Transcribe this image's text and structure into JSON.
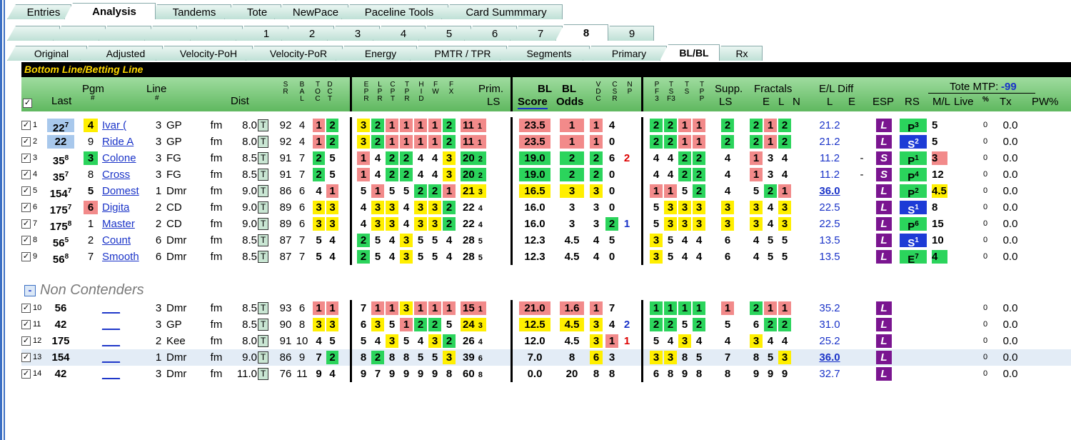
{
  "tabs_main": [
    "Entries",
    "Analysis",
    "Tandems",
    "Tote",
    "NewPace",
    "Paceline Tools",
    "Card Summmary"
  ],
  "tabs_races": [
    "",
    "",
    "",
    "",
    "",
    "1",
    "2",
    "3",
    "4",
    "5",
    "6",
    "7",
    "8",
    "9"
  ],
  "tabs_sub": [
    "Original",
    "Adjusted",
    "Velocity-PoH",
    "Velocity-PoR",
    "Energy",
    "PMTR / TPR",
    "Segments",
    "Primary",
    "BL/BL",
    "Rx"
  ],
  "title": "Bottom Line/Betting Line",
  "headers": {
    "last": "Last",
    "pgm": "Pgm",
    "pgm2": "#",
    "line": "Line",
    "line2": "#",
    "dist": "Dist",
    "sr": "S R",
    "bal": "B A L",
    "toc": "T O C",
    "dct": "D C T",
    "e": "E P R",
    "l": "L P R",
    "c": "C P T",
    "t": "T P R",
    "hd": "H I D",
    "w": "F W",
    "fx": "F X",
    "prim": "Prim.",
    "ls": "LS",
    "bl1": "BL",
    "bl2": "BL",
    "score": "Score",
    "odds": "Odds",
    "vdc": "V D C",
    "csr": "C S R",
    "np": "N P",
    "pf": "P F 3",
    "tf": "T S F3",
    "ts": "T S",
    "tp": "T P P",
    "supp": "Supp.",
    "suppls": "LS",
    "fract": "Fractals",
    "e2": "E",
    "l2": "L",
    "n2": "N",
    "eldiff": "E/L Diff",
    "el_l": "L",
    "el_e": "E",
    "esp": "ESP",
    "rs": "RS",
    "tote": "Tote MTP:",
    "mtp": "-99",
    "ml": "M/L",
    "live": "Live",
    "pct": "%",
    "tx": "Tx",
    "pw": "PW%"
  },
  "rows": [
    {
      "n": "1",
      "last": "22",
      "sup": "7",
      "pgm": "4",
      "name": "Ivar (",
      "line": "3",
      "trk": "GP",
      "surf": "fm",
      "dist": "8.0",
      "sr": "92",
      "bal": "4",
      "toc": "1",
      "dct": "2",
      "fr": [
        "3",
        "2",
        "1",
        "1",
        "1",
        "1",
        "2"
      ],
      "prim": "11",
      "pls": "1",
      "score": "23.5",
      "odds": "1",
      "vdc": "1",
      "csr": "4",
      "np": "",
      "pc": [
        "2",
        "2",
        "1",
        "1"
      ],
      "supp": "2",
      "fx": [
        "2",
        "1",
        "2"
      ],
      "el": "21.2",
      "dash": "",
      "esp": "L",
      "rs": "P",
      "rss": "3",
      "ml": "5",
      "live": "0",
      "pct": "0.0"
    },
    {
      "n": "2",
      "last": "22",
      "sup": "",
      "pgm": "9",
      "name": "Ride A",
      "line": "3",
      "trk": "GP",
      "surf": "fm",
      "dist": "8.0",
      "sr": "92",
      "bal": "4",
      "toc": "1",
      "dct": "2",
      "fr": [
        "3",
        "2",
        "1",
        "1",
        "1",
        "1",
        "2"
      ],
      "prim": "11",
      "pls": "1",
      "score": "23.5",
      "odds": "1",
      "vdc": "1",
      "csr": "0",
      "np": "",
      "pc": [
        "2",
        "2",
        "1",
        "1"
      ],
      "supp": "2",
      "fx": [
        "2",
        "1",
        "2"
      ],
      "el": "21.2",
      "dash": "",
      "esp": "L",
      "rs": "S",
      "rss": "2",
      "ml": "5",
      "live": "0",
      "pct": "0.0"
    },
    {
      "n": "3",
      "last": "35",
      "sup": "8",
      "pgm": "3",
      "name": "Colone",
      "line": "3",
      "trk": "FG",
      "surf": "fm",
      "dist": "8.5",
      "sr": "91",
      "bal": "7",
      "toc": "2",
      "dct": "5",
      "fr": [
        "1",
        "4",
        "2",
        "2",
        "4",
        "4",
        "3"
      ],
      "prim": "20",
      "pls": "2",
      "score": "19.0",
      "odds": "2",
      "vdc": "2",
      "csr": "6",
      "np": "2",
      "pc": [
        "4",
        "4",
        "2",
        "2"
      ],
      "supp": "4",
      "fx": [
        "1",
        "3",
        "4"
      ],
      "el": "11.2",
      "dash": "-",
      "esp": "S",
      "rs": "P",
      "rss": "1",
      "ml": "3",
      "live": "0",
      "pct": "0.0"
    },
    {
      "n": "4",
      "last": "35",
      "sup": "7",
      "pgm": "8",
      "name": "Cross",
      "line": "3",
      "trk": "FG",
      "surf": "fm",
      "dist": "8.5",
      "sr": "91",
      "bal": "7",
      "toc": "2",
      "dct": "5",
      "fr": [
        "1",
        "4",
        "2",
        "2",
        "4",
        "4",
        "3"
      ],
      "prim": "20",
      "pls": "2",
      "score": "19.0",
      "odds": "2",
      "vdc": "2",
      "csr": "0",
      "np": "",
      "pc": [
        "4",
        "4",
        "2",
        "2"
      ],
      "supp": "4",
      "fx": [
        "1",
        "3",
        "4"
      ],
      "el": "11.2",
      "dash": "-",
      "esp": "S",
      "rs": "P",
      "rss": "4",
      "ml": "12",
      "live": "0",
      "pct": "0.0"
    },
    {
      "n": "5",
      "last": "154",
      "sup": "7",
      "pgm": "5",
      "name": "Domest",
      "line": "1",
      "trk": "Dmr",
      "surf": "fm",
      "dist": "9.0",
      "sr": "86",
      "bal": "6",
      "toc": "4",
      "dct": "1",
      "fr": [
        "5",
        "1",
        "5",
        "5",
        "2",
        "2",
        "1"
      ],
      "prim": "21",
      "pls": "3",
      "score": "16.5",
      "odds": "3",
      "vdc": "3",
      "csr": "0",
      "np": "",
      "pc": [
        "1",
        "1",
        "5",
        "2"
      ],
      "supp": "4",
      "fx": [
        "5",
        "2",
        "1"
      ],
      "el": "36.0",
      "dash": "",
      "esp": "L",
      "rs": "P",
      "rss": "2",
      "ml": "4.5",
      "live": "0",
      "pct": "0.0"
    },
    {
      "n": "6",
      "last": "175",
      "sup": "7",
      "pgm": "6",
      "name": "Digita",
      "line": "2",
      "trk": "CD",
      "surf": "fm",
      "dist": "9.0",
      "sr": "89",
      "bal": "6",
      "toc": "3",
      "dct": "3",
      "fr": [
        "4",
        "3",
        "3",
        "4",
        "3",
        "3",
        "2"
      ],
      "prim": "22",
      "pls": "4",
      "score": "16.0",
      "odds": "3",
      "vdc": "3",
      "csr": "0",
      "np": "",
      "pc": [
        "5",
        "3",
        "3",
        "3"
      ],
      "supp": "3",
      "fx": [
        "3",
        "4",
        "3"
      ],
      "el": "22.5",
      "dash": "",
      "esp": "L",
      "rs": "S",
      "rss": "1",
      "ml": "8",
      "live": "0",
      "pct": "0.0"
    },
    {
      "n": "7",
      "last": "175",
      "sup": "8",
      "pgm": "1",
      "name": "Master",
      "line": "2",
      "trk": "CD",
      "surf": "fm",
      "dist": "9.0",
      "sr": "89",
      "bal": "6",
      "toc": "3",
      "dct": "3",
      "fr": [
        "4",
        "3",
        "3",
        "4",
        "3",
        "3",
        "2"
      ],
      "prim": "22",
      "pls": "4",
      "score": "16.0",
      "odds": "3",
      "vdc": "3",
      "csr": "2",
      "np": "1",
      "pc": [
        "5",
        "3",
        "3",
        "3"
      ],
      "supp": "3",
      "fx": [
        "3",
        "4",
        "3"
      ],
      "el": "22.5",
      "dash": "",
      "esp": "L",
      "rs": "P",
      "rss": "6",
      "ml": "15",
      "live": "0",
      "pct": "0.0"
    },
    {
      "n": "8",
      "last": "56",
      "sup": "5",
      "pgm": "2",
      "name": "Count",
      "line": "6",
      "trk": "Dmr",
      "surf": "fm",
      "dist": "8.5",
      "sr": "87",
      "bal": "7",
      "toc": "5",
      "dct": "4",
      "fr": [
        "2",
        "5",
        "4",
        "3",
        "5",
        "5",
        "4"
      ],
      "prim": "28",
      "pls": "5",
      "score": "12.3",
      "odds": "4.5",
      "vdc": "4",
      "csr": "5",
      "np": "",
      "pc": [
        "3",
        "5",
        "4",
        "4"
      ],
      "supp": "6",
      "fx": [
        "4",
        "5",
        "5"
      ],
      "el": "13.5",
      "dash": "",
      "esp": "L",
      "rs": "S",
      "rss": "1",
      "ml": "10",
      "live": "0",
      "pct": "0.0"
    },
    {
      "n": "9",
      "last": "56",
      "sup": "8",
      "pgm": "7",
      "name": "Smooth",
      "line": "6",
      "trk": "Dmr",
      "surf": "fm",
      "dist": "8.5",
      "sr": "87",
      "bal": "7",
      "toc": "5",
      "dct": "4",
      "fr": [
        "2",
        "5",
        "4",
        "3",
        "5",
        "5",
        "4"
      ],
      "prim": "28",
      "pls": "5",
      "score": "12.3",
      "odds": "4.5",
      "vdc": "4",
      "csr": "0",
      "np": "",
      "pc": [
        "3",
        "5",
        "4",
        "4"
      ],
      "supp": "6",
      "fx": [
        "4",
        "5",
        "5"
      ],
      "el": "13.5",
      "dash": "",
      "esp": "L",
      "rs": "E",
      "rss": "7",
      "ml": "4",
      "live": "0",
      "pct": "0.0"
    }
  ],
  "noncontenders_label": "Non Contenders",
  "nc_rows": [
    {
      "n": "10",
      "last": "56",
      "name": "___",
      "line": "3",
      "trk": "Dmr",
      "surf": "fm",
      "dist": "8.5",
      "sr": "93",
      "bal": "6",
      "toc": "1",
      "dct": "1",
      "fr": [
        "7",
        "1",
        "1",
        "3",
        "1",
        "1",
        "1"
      ],
      "prim": "15",
      "pls": "1",
      "score": "21.0",
      "odds": "1.6",
      "vdc": "1",
      "csr": "7",
      "np": "",
      "pc": [
        "1",
        "1",
        "1",
        "1"
      ],
      "supp": "1",
      "fx": [
        "2",
        "1",
        "1"
      ],
      "el": "35.2",
      "esp": "L",
      "live": "0",
      "pct": "0.0"
    },
    {
      "n": "11",
      "last": "42",
      "name": "___",
      "line": "3",
      "trk": "GP",
      "surf": "fm",
      "dist": "8.5",
      "sr": "90",
      "bal": "8",
      "toc": "3",
      "dct": "3",
      "fr": [
        "6",
        "3",
        "5",
        "1",
        "2",
        "2",
        "5"
      ],
      "prim": "24",
      "pls": "3",
      "score": "12.5",
      "odds": "4.5",
      "vdc": "3",
      "csr": "4",
      "np": "2",
      "pc": [
        "2",
        "2",
        "5",
        "2"
      ],
      "supp": "5",
      "fx": [
        "6",
        "2",
        "2"
      ],
      "el": "31.0",
      "esp": "L",
      "live": "0",
      "pct": "0.0"
    },
    {
      "n": "12",
      "last": "175",
      "name": "___",
      "line": "2",
      "trk": "Kee",
      "surf": "fm",
      "dist": "8.0",
      "sr": "91",
      "bal": "10",
      "toc": "4",
      "dct": "5",
      "fr": [
        "5",
        "4",
        "3",
        "5",
        "4",
        "3",
        "2"
      ],
      "prim": "26",
      "pls": "4",
      "score": "12.0",
      "odds": "4.5",
      "vdc": "3",
      "csr": "1",
      "np": "1",
      "pc": [
        "5",
        "4",
        "3",
        "4"
      ],
      "supp": "4",
      "fx": [
        "3",
        "4",
        "4"
      ],
      "el": "25.2",
      "esp": "L",
      "live": "0",
      "pct": "0.0"
    },
    {
      "n": "13",
      "last": "154",
      "name": "___",
      "line": "1",
      "trk": "Dmr",
      "surf": "fm",
      "dist": "9.0",
      "sr": "86",
      "bal": "9",
      "toc": "7",
      "dct": "2",
      "fr": [
        "8",
        "2",
        "8",
        "8",
        "5",
        "5",
        "3"
      ],
      "prim": "39",
      "pls": "6",
      "score": "7.0",
      "odds": "8",
      "vdc": "6",
      "csr": "3",
      "np": "",
      "pc": [
        "3",
        "3",
        "8",
        "5"
      ],
      "supp": "7",
      "fx": [
        "8",
        "5",
        "3"
      ],
      "el": "36.0",
      "esp": "L",
      "live": "0",
      "pct": "0.0"
    },
    {
      "n": "14",
      "last": "42",
      "name": "___",
      "line": "3",
      "trk": "Dmr",
      "surf": "fm",
      "dist": "11.0",
      "sr": "76",
      "bal": "11",
      "toc": "9",
      "dct": "4",
      "fr": [
        "9",
        "7",
        "9",
        "9",
        "9",
        "9",
        "8"
      ],
      "prim": "60",
      "pls": "8",
      "score": "0.0",
      "odds": "20",
      "vdc": "8",
      "csr": "8",
      "np": "",
      "pc": [
        "6",
        "8",
        "9",
        "8"
      ],
      "supp": "8",
      "fx": [
        "9",
        "9",
        "9"
      ],
      "el": "32.7",
      "esp": "L",
      "live": "0",
      "pct": "0.0"
    }
  ],
  "colors": {
    "red": "#f28a8a",
    "green": "#2bd45c",
    "yellow": "#ffef00",
    "esp": "#7a1590",
    "rs_blue": "#1d3bd6",
    "title_bg": "#000000",
    "title_fg": "#ffd800"
  },
  "tote_box_label": "T",
  "check_mark": "✓"
}
